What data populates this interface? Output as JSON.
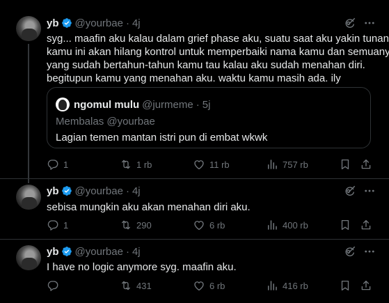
{
  "tweets": [
    {
      "name": "yb",
      "handle": "@yourbae",
      "time": "4j",
      "lines": [
        "syg... maafin aku kalau dalam grief phase aku, suatu saat aku yakin tunangan",
        "kamu ini akan hilang kontrol untuk memperbaiki nama kamu dan semuanya,",
        "yang sudah bertahun-tahun kamu tau kalau aku sudah menahan diri.",
        "begitupun kamu yang menahan aku. waktu kamu masih ada. ily"
      ],
      "quote": {
        "name": "ngomul mulu",
        "handle": "@jurmeme",
        "time": "5j",
        "reply_to": "Membalas @yourbae",
        "text": "Lagian temen mantan istri pun di embat wkwk"
      },
      "replies": "1",
      "reposts": "1 rb",
      "likes": "11 rb",
      "views": "757 rb"
    },
    {
      "name": "yb",
      "handle": "@yourbae",
      "time": "4j",
      "lines": [
        "sebisa mungkin aku akan menahan diri aku."
      ],
      "replies": "1",
      "reposts": "290",
      "likes": "6 rb",
      "views": "400 rb"
    },
    {
      "name": "yb",
      "handle": "@yourbae",
      "time": "4j",
      "lines": [
        "I have no logic anymore syg. maafin aku."
      ],
      "replies": "",
      "reposts": "431",
      "likes": "6 rb",
      "views": "416 rb"
    }
  ],
  "separator": "·",
  "colors": {
    "background": "#000000",
    "text": "#e7e9ea",
    "secondary": "#71767b",
    "verified": "#1d9bf0",
    "border": "#2f3336"
  },
  "icons": [
    "verified-badge-icon",
    "grok-icon",
    "more-icon",
    "reply-icon",
    "repost-icon",
    "like-icon",
    "views-icon",
    "bookmark-icon",
    "share-icon"
  ]
}
